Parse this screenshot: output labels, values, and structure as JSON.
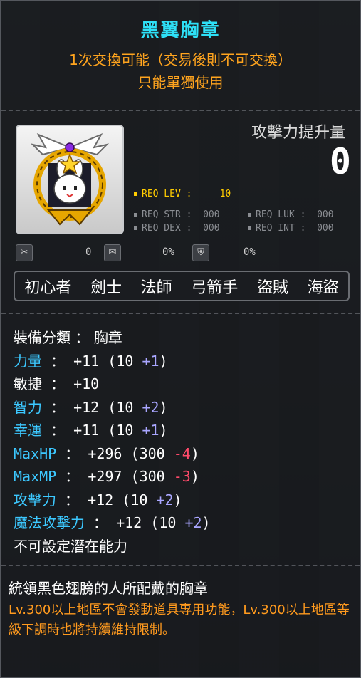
{
  "item": {
    "name": "黑翼胸章",
    "trade_note": "1次交換可能（交易後則不可交換）",
    "use_note": "只能單獨使用"
  },
  "attack_increase": {
    "label": "攻擊力提升量",
    "value": "0"
  },
  "requirements": {
    "lev_label": "REQ LEV :",
    "lev_value": "10",
    "str_label": "REQ STR :",
    "str_value": "000",
    "luk_label": "REQ LUK :",
    "luk_value": "000",
    "dex_label": "REQ DEX :",
    "dex_value": "000",
    "int_label": "REQ INT :",
    "int_value": "000"
  },
  "indicators": [
    {
      "icon": "scissors-icon",
      "value": "0"
    },
    {
      "icon": "envelope-icon",
      "value": "0%"
    },
    {
      "icon": "shield-icon",
      "value": "0%"
    }
  ],
  "jobs": [
    "初心者",
    "劍士",
    "法師",
    "弓箭手",
    "盜賊",
    "海盜"
  ],
  "stats": {
    "category": {
      "label": "裝備分類 ： ",
      "value": "胸章"
    },
    "str": {
      "label": "力量",
      "sep": " ： ",
      "total": "+11",
      "base": "10",
      "bonus": "+1"
    },
    "dex": {
      "label": "敏捷",
      "sep": " ： ",
      "total": "+10"
    },
    "int": {
      "label": "智力",
      "sep": " ： ",
      "total": "+12",
      "base": "10",
      "bonus": "+2"
    },
    "luk": {
      "label": "幸運",
      "sep": " ： ",
      "total": "+11",
      "base": "10",
      "bonus": "+1"
    },
    "maxhp": {
      "label": "MaxHP",
      "sep": " ： ",
      "total": "+296",
      "base": "300",
      "bonus": "-4"
    },
    "maxmp": {
      "label": "MaxMP",
      "sep": " ： ",
      "total": "+297",
      "base": "300",
      "bonus": "-3"
    },
    "atk": {
      "label": "攻擊力",
      "sep": " ： ",
      "total": "+12",
      "base": "10",
      "bonus": "+2"
    },
    "matk": {
      "label": "魔法攻擊力",
      "sep": " ： ",
      "total": "+12",
      "base": "10",
      "bonus": "+2"
    },
    "potential": "不可設定潛在能力"
  },
  "description": {
    "flavor": "統領黑色翅膀的人所配戴的胸章",
    "restriction": "Lv.300以上地區不會發動道具專用功能，Lv.300以上地區等級下調時也將持續維持限制。"
  },
  "colors": {
    "title": "#2ee0f6",
    "note": "#ffa41e",
    "stat_cyan": "#3cc8ff",
    "bonus_plus": "#a9a6ff",
    "bonus_minus": "#ff4a6a",
    "req_lev": "#ffcc00"
  }
}
